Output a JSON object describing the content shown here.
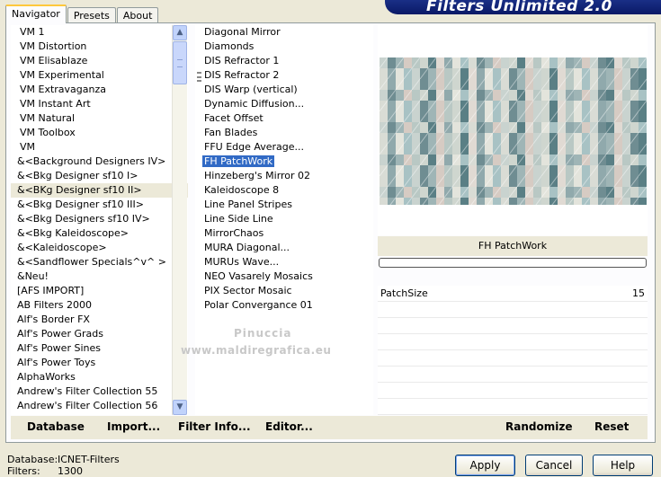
{
  "tabs": [
    "Navigator",
    "Presets",
    "About"
  ],
  "banner": "Filters Unlimited 2.0",
  "categories": [
    "VM 1",
    "VM Distortion",
    "VM Elisablaze",
    "VM Experimental",
    "VM Extravaganza",
    "VM Instant Art",
    "VM Natural",
    "VM Toolbox",
    "VM",
    "&<Background Designers IV>",
    "&<Bkg Designer sf10 I>",
    "&<BKg Designer sf10 II>",
    "&<Bkg Designer sf10 III>",
    "&<Bkg Designers sf10 IV>",
    "&<Bkg Kaleidoscope>",
    "&<Kaleidoscope>",
    "&<Sandflower Specials^v^ >",
    "&Neu!",
    "[AFS IMPORT]",
    "AB Filters 2000",
    "Alf's Border FX",
    "Alf's Power Grads",
    "Alf's Power Sines",
    "Alf's Power Toys",
    "AlphaWorks",
    "Andrew's Filter Collection 55",
    "Andrew's Filter Collection 56"
  ],
  "selected_category": "&<BKg Designer sf10 II>",
  "filters": [
    "Diagonal Mirror",
    "Diamonds",
    "DIS Refractor 1",
    "DIS Refractor 2",
    "DIS Warp (vertical)",
    "Dynamic Diffusion...",
    "Facet Offset",
    "Fan Blades",
    "FFU Edge Average...",
    "FH PatchWork",
    "Hinzeberg's Mirror 02",
    "Kaleidoscope 8",
    "Line Panel Stripes",
    "Line Side Line",
    "MirrorChaos",
    "MURA Diagonal...",
    "MURUs Wave...",
    "NEO Vasarely Mosaics",
    "PIX Sector Mosaic",
    "Polar Convergance 01"
  ],
  "selected_filter": "FH PatchWork",
  "watermark": [
    "Pinuccia",
    "www.maldiregrafica.eu"
  ],
  "filter_title": "FH PatchWork",
  "progress": 0,
  "params": [
    {
      "name": "PatchSize",
      "value": "15"
    }
  ],
  "bottom_buttons": [
    "Database",
    "Import...",
    "Filter Info...",
    "Editor...",
    "Randomize",
    "Reset"
  ],
  "status": {
    "database_label": "Database:",
    "database_value": "ICNET-Filters",
    "filters_label": "Filters:",
    "filters_value": "1300"
  },
  "dialog_buttons": {
    "apply": "Apply",
    "cancel": "Cancel",
    "help": "Help"
  },
  "preview_colors": [
    "#d9dcd5",
    "#c9d3cf",
    "#b9c8c4",
    "#90a9ac",
    "#6f8d92",
    "#cfd6cf",
    "#e3e4dc",
    "#9fb5b6",
    "#5a7f85",
    "#a8c2c4",
    "#d6cbc3",
    "#e0dad3"
  ]
}
